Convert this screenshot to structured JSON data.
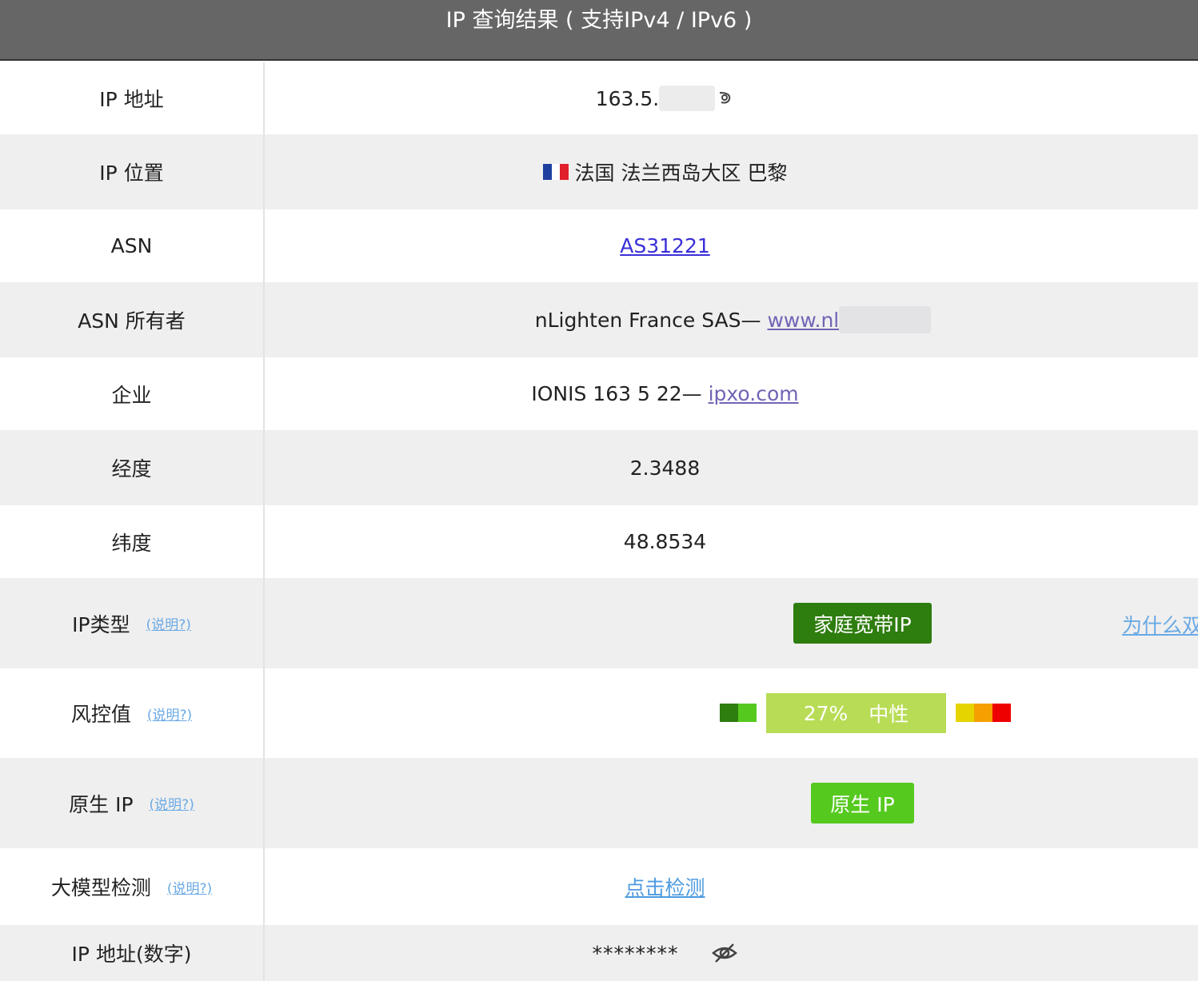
{
  "header": {
    "title": "IP 查询结果 ( 支持IPv4 / IPv6 )"
  },
  "help_text": "(说明?)",
  "rows": {
    "ip": {
      "label": "IP 地址",
      "value": "163.5."
    },
    "location": {
      "label": "IP 位置",
      "flag": "🇫🇷",
      "value": "法国 法兰西岛大区 巴黎"
    },
    "asn": {
      "label": "ASN",
      "value": "AS31221"
    },
    "asn_owner": {
      "label": "ASN 所有者",
      "prefix": "nLighten France SAS— ",
      "link": "www.nl"
    },
    "company": {
      "label": "企业",
      "prefix": "IONIS 163 5 22— ",
      "link": "ipxo.com"
    },
    "longitude": {
      "label": "经度",
      "value": "2.3488"
    },
    "latitude": {
      "label": "纬度",
      "value": "48.8534"
    },
    "ip_type": {
      "label": "IP类型",
      "badge": "家庭宽带IP",
      "why_link": "为什么双"
    },
    "risk": {
      "label": "风控值",
      "percent_text": "27%",
      "level_text": "中性",
      "value_percent": 27
    },
    "native": {
      "label": "原生 IP",
      "badge": "原生 IP"
    },
    "llm": {
      "label": "大模型检测",
      "link": "点击检测"
    },
    "ip_numeric": {
      "label": "IP 地址(数字)",
      "masked": "********"
    }
  },
  "colors": {
    "header_bg": "#666666",
    "row_alt_bg": "#efefef",
    "ip_type_badge": "#2e7d0f",
    "risk_main": "#b8dc55",
    "native_badge": "#56c91f",
    "risk_scale": [
      "#2e7d0f",
      "#56c91f",
      "#b8dc55",
      "#e6d400",
      "#f5a000",
      "#ee0000"
    ]
  }
}
